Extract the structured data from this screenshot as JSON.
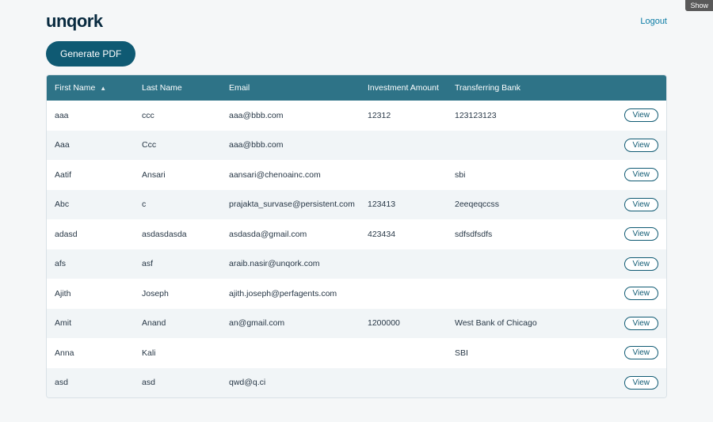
{
  "shell": {
    "show_badge": "Show",
    "logo": "unqork",
    "logout": "Logout"
  },
  "actions": {
    "generate_pdf": "Generate PDF",
    "view": "View"
  },
  "table": {
    "columns": {
      "first_name": "First Name",
      "last_name": "Last Name",
      "email": "Email",
      "investment_amount": "Investment Amount",
      "transferring_bank": "Transferring Bank"
    },
    "sort": {
      "column": "first_name",
      "direction": "asc",
      "icon": "▲"
    },
    "rows": [
      {
        "first_name": "aaa",
        "last_name": "ccc",
        "email": "aaa@bbb.com",
        "investment_amount": "12312",
        "transferring_bank": "123123123"
      },
      {
        "first_name": "Aaa",
        "last_name": "Ccc",
        "email": "aaa@bbb.com",
        "investment_amount": "",
        "transferring_bank": ""
      },
      {
        "first_name": "Aatif",
        "last_name": "Ansari",
        "email": "aansari@chenoainc.com",
        "investment_amount": "",
        "transferring_bank": "sbi"
      },
      {
        "first_name": "Abc",
        "last_name": "c",
        "email": "prajakta_survase@persistent.com",
        "investment_amount": "123413",
        "transferring_bank": "2eeqeqccss"
      },
      {
        "first_name": "adasd",
        "last_name": "asdasdasda",
        "email": "asdasda@gmail.com",
        "investment_amount": "423434",
        "transferring_bank": "sdfsdfsdfs"
      },
      {
        "first_name": "afs",
        "last_name": "asf",
        "email": "araib.nasir@unqork.com",
        "investment_amount": "",
        "transferring_bank": ""
      },
      {
        "first_name": "Ajith",
        "last_name": "Joseph",
        "email": "ajith.joseph@perfagents.com",
        "investment_amount": "",
        "transferring_bank": ""
      },
      {
        "first_name": "Amit",
        "last_name": "Anand",
        "email": "an@gmail.com",
        "investment_amount": "1200000",
        "transferring_bank": "West Bank of Chicago"
      },
      {
        "first_name": "Anna",
        "last_name": "Kali",
        "email": "",
        "investment_amount": "",
        "transferring_bank": "SBI"
      },
      {
        "first_name": "asd",
        "last_name": "asd",
        "email": "qwd@q.ci",
        "investment_amount": "",
        "transferring_bank": ""
      }
    ]
  }
}
